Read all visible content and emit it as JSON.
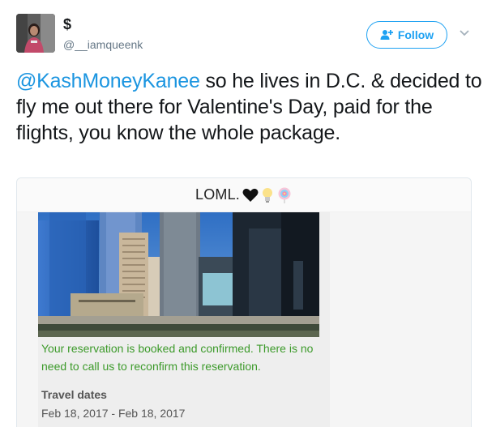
{
  "author": {
    "display_name": "$",
    "handle": "@__iamqueenk"
  },
  "actions": {
    "follow_label": "Follow"
  },
  "tweet": {
    "mention": "@KashMoneyKanee",
    "text": " so he lives in D.C. & decided to fly me out there for Valentine's Day, paid for the flights, you know the whole package."
  },
  "media": {
    "story_title": "LOML.",
    "emojis": [
      "black-heart-icon",
      "lightbulb-icon",
      "lollipop-icon"
    ],
    "confirmation_text": "Your reservation is booked and confirmed. There is no need to call us to reconfirm this reservation.",
    "travel_label": "Travel dates",
    "travel_dates": "Feb 18, 2017 - Feb 18, 2017"
  },
  "colors": {
    "accent": "#1da1f2",
    "mention": "#1b95e0",
    "confirmation": "#3c9a2a"
  }
}
